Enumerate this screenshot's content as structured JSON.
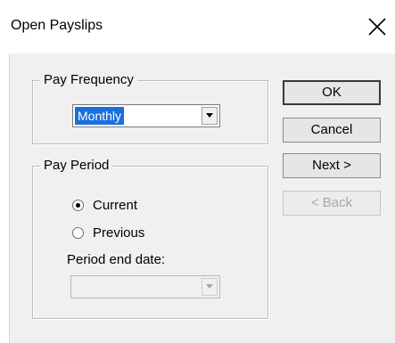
{
  "window": {
    "title": "Open Payslips"
  },
  "pay_frequency": {
    "legend": "Pay Frequency",
    "selected": "Monthly"
  },
  "pay_period": {
    "legend": "Pay Period",
    "options": [
      {
        "label": "Current",
        "checked": true
      },
      {
        "label": "Previous",
        "checked": false
      }
    ],
    "period_end_label": "Period end date:",
    "period_end_value": ""
  },
  "buttons": {
    "ok": "OK",
    "cancel": "Cancel",
    "next": "Next >",
    "back": "< Back"
  },
  "colors": {
    "selection": "#1a6fdc",
    "dialog_bg": "#f0f0f0"
  },
  "icons": {
    "close": "close-icon",
    "dropdown": "chevron-down-icon"
  }
}
